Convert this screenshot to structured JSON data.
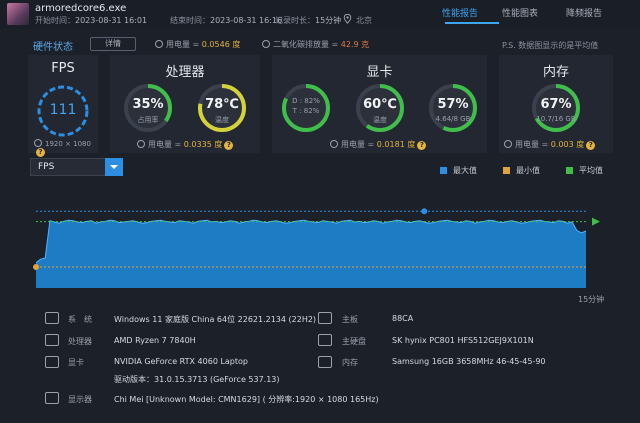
{
  "header": {
    "app_name": "armoredcore6.exe",
    "start_label": "开始时间：",
    "start_time": "2023-08-31 16:01",
    "end_label": "结束时间：",
    "end_time": "2023-08-31 16:16",
    "duration_label": "记录时长：",
    "duration": "15分钟",
    "location": "北京"
  },
  "tabs": [
    {
      "label": "性能报告",
      "active": true
    },
    {
      "label": "性能图表",
      "active": false
    },
    {
      "label": "降频报告",
      "active": false
    }
  ],
  "summary": {
    "title": "硬件状态",
    "details_button": "详情",
    "power_label": "用电量 = ",
    "power_value": "0.0546 度",
    "co2_label": "二氧化碳排放量 = ",
    "co2_value": "42.9 克",
    "note": "P.S. 数据图显示的是平均值"
  },
  "fps_card": {
    "title": "FPS",
    "value": "111",
    "resolution": "1920 × 1080"
  },
  "cpu_card": {
    "title": "处理器",
    "usage_value": "35%",
    "usage_percent": 35,
    "usage_label": "占用率",
    "temp_value": "78℃",
    "temp_percent": 78,
    "temp_label": "温度",
    "power_label": "用电量 = ",
    "power_value": "0.0335 度"
  },
  "gpu_card": {
    "title": "显卡",
    "d_label": "D : 82%",
    "t_label": "T : 82%",
    "d_percent": 82,
    "temp_value": "60℃",
    "temp_percent": 60,
    "temp_label": "温度",
    "vram_value": "57%",
    "vram_percent": 57,
    "vram_label": "4.64/8 GB",
    "power_label": "用电量 = ",
    "power_value": "0.0181 度"
  },
  "mem_card": {
    "title": "内存",
    "usage_value": "67%",
    "usage_percent": 67,
    "usage_label": "10.7/16 GB",
    "power_label": "用电量 = ",
    "power_value": "0.003 度"
  },
  "chart_controls": {
    "dropdown_value": "FPS",
    "legend": [
      {
        "label": "最大值",
        "color": "#2d8fe3"
      },
      {
        "label": "最小值",
        "color": "#e4a23b"
      },
      {
        "label": "平均值",
        "color": "#3fbf4a"
      }
    ]
  },
  "chart_data": {
    "type": "area",
    "series": [
      {
        "name": "FPS",
        "values": [
          42,
          48,
          50,
          112,
          110,
          108,
          111,
          113,
          112,
          110,
          109,
          111,
          112,
          108,
          110,
          111,
          113,
          112,
          109,
          110,
          111,
          112,
          110,
          108,
          109,
          111,
          112,
          113,
          111,
          110,
          109,
          112,
          111,
          110,
          108,
          111,
          112,
          113,
          110,
          111,
          109,
          110,
          112,
          111,
          108,
          110,
          111,
          113,
          112,
          110,
          109,
          111,
          112,
          110,
          108,
          109,
          111,
          112,
          113,
          111,
          110,
          109,
          112,
          111,
          110,
          108,
          111,
          112,
          113,
          110,
          111,
          109,
          110,
          112,
          111,
          108,
          110,
          111,
          113,
          112,
          110,
          109,
          111,
          112,
          110,
          108,
          109,
          111,
          112,
          113,
          111,
          110,
          109,
          112,
          111,
          108,
          110,
          111,
          113,
          112,
          110,
          109,
          111,
          112,
          110,
          108,
          109,
          111,
          112,
          113,
          111,
          110,
          109,
          112,
          111,
          108,
          110,
          96,
          92,
          95
        ]
      }
    ],
    "markers": {
      "max": 128,
      "min": 35,
      "avg": 110.61
    },
    "x_label_end": "15分钟",
    "ylim": [
      0,
      140
    ]
  },
  "sysinfo": {
    "left": [
      {
        "label": "系　统",
        "value": "Windows 11 家庭版 China 64位 22621.2134 (22H2)",
        "icon": "system-icon"
      },
      {
        "label": "处理器",
        "value": "AMD Ryzen 7 7840H",
        "icon": "cpu-icon"
      },
      {
        "label": "显卡",
        "value": "NVIDIA GeForce RTX 4060 Laptop",
        "icon": "gpu-icon"
      },
      {
        "label": "",
        "value": "驱动版本：31.0.15.3713 (GeForce 537.13)",
        "icon": ""
      },
      {
        "label": "显示器",
        "value": "Chi Mei [Unknown Model: CMN1629]  ( 分辨率:1920 × 1080 165Hz)",
        "icon": "monitor-icon"
      }
    ],
    "right": [
      {
        "label": "主板",
        "value": "88CA",
        "icon": "motherboard-icon"
      },
      {
        "label": "主硬盘",
        "value": "SK hynix PC801 HFS512GEJ9X101N",
        "icon": "disk-icon"
      },
      {
        "label": "内存",
        "value": "Samsung 16GB 3658MHz 46-45-45-90",
        "icon": "memory-icon"
      }
    ]
  }
}
